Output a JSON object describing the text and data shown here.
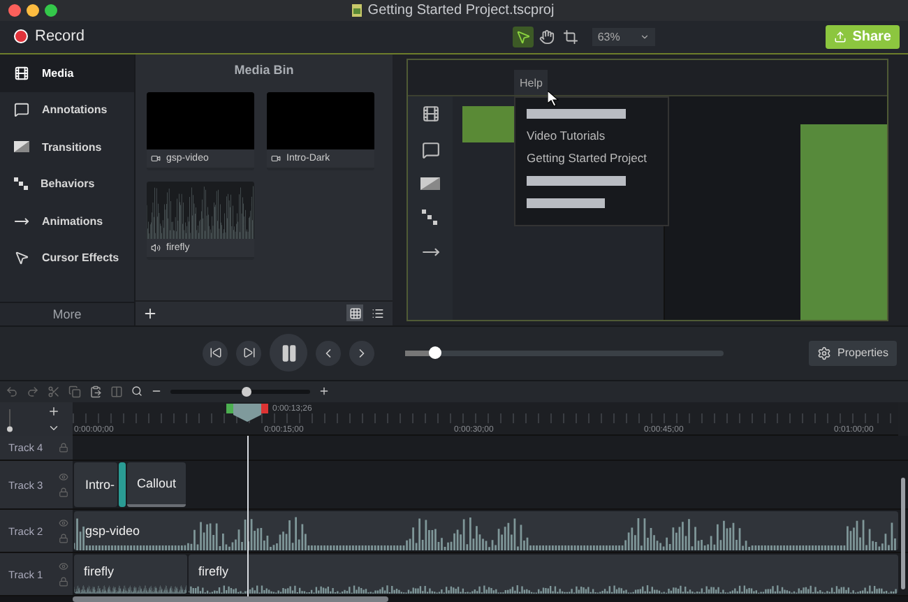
{
  "window": {
    "title": "Getting Started Project.tscproj"
  },
  "toolbar": {
    "record": "Record",
    "tools": [
      {
        "kind": "select",
        "selected": true
      },
      {
        "kind": "hand",
        "selected": false
      },
      {
        "kind": "crop",
        "selected": false
      }
    ],
    "zoom": "63%",
    "share": "Share"
  },
  "sidebar": {
    "items": [
      {
        "kind": "media",
        "label": "Media",
        "selected": true
      },
      {
        "kind": "annotations",
        "label": "Annotations",
        "selected": false
      },
      {
        "kind": "transitions",
        "label": "Transitions",
        "selected": false
      },
      {
        "kind": "behaviors",
        "label": "Behaviors",
        "selected": false
      },
      {
        "kind": "animations",
        "label": "Animations",
        "selected": false
      },
      {
        "kind": "cursor",
        "label": "Cursor Effects",
        "selected": false
      }
    ],
    "more": "More"
  },
  "media_bin": {
    "title": "Media Bin",
    "items": [
      {
        "kind": "video",
        "name": "gsp-video"
      },
      {
        "kind": "video",
        "name": "Intro-Dark"
      },
      {
        "kind": "audio",
        "name": "firefly"
      }
    ],
    "views": [
      {
        "kind": "grid",
        "selected": true
      },
      {
        "kind": "list",
        "selected": false
      }
    ]
  },
  "canvas": {
    "menu_title": "Help",
    "menu_items": [
      {
        "kind": "redacted"
      },
      {
        "kind": "text",
        "label": "Video Tutorials"
      },
      {
        "kind": "text",
        "label": "Getting Started Project"
      },
      {
        "kind": "redacted"
      },
      {
        "kind": "redacted"
      }
    ]
  },
  "playback": {
    "scrubber": {
      "level": 0.09
    },
    "properties": "Properties"
  },
  "timeline": {
    "track_size": {
      "level": 0.05
    },
    "zoom": {
      "level": 0.55
    },
    "playhead": "0:00:13;26",
    "marks": [
      "0:00:00;00",
      "0:00:15;00",
      "0:00:30;00",
      "0:00:45;00",
      "0:01:00;00"
    ],
    "tracks": [
      {
        "name": "Track 4"
      },
      {
        "name": "Track 3",
        "clips": [
          {
            "kind": "video",
            "label": "Intro-"
          },
          {
            "kind": "transition"
          },
          {
            "kind": "callout",
            "label": "Callout"
          }
        ]
      },
      {
        "name": "Track 2",
        "clips": [
          {
            "kind": "video",
            "label": "gsp-video",
            "waveform": true
          }
        ]
      },
      {
        "name": "Track 1",
        "clips": [
          {
            "kind": "audio",
            "label": "firefly"
          },
          {
            "kind": "audio",
            "label": "firefly"
          }
        ]
      }
    ]
  }
}
